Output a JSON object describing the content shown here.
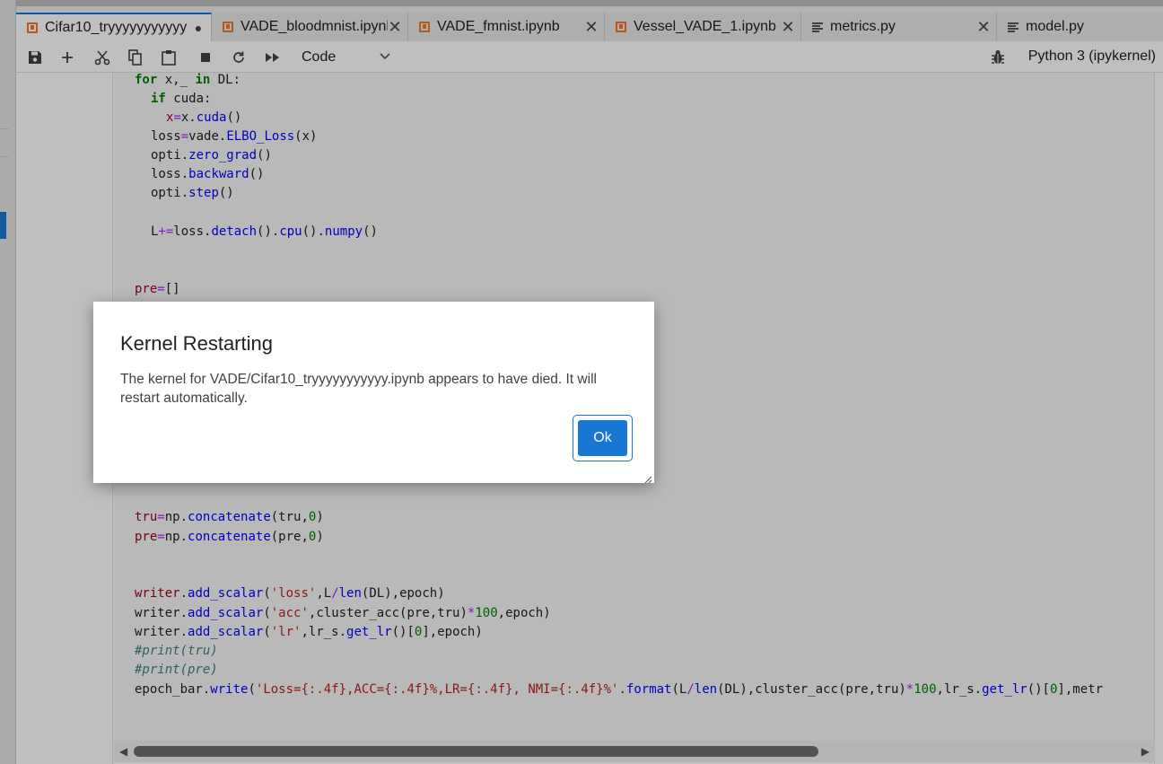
{
  "tabs": [
    {
      "label": "Cifar10_tryyyyyyyyyyy",
      "icon": "notebook-icon",
      "active": true,
      "modified": true
    },
    {
      "label": "VADE_bloodmnist.ipynb",
      "icon": "notebook-icon",
      "close": "✕"
    },
    {
      "label": "VADE_fmnist.ipynb",
      "icon": "notebook-icon",
      "close": "✕"
    },
    {
      "label": "Vessel_VADE_1.ipynb",
      "icon": "notebook-icon",
      "close": "✕"
    },
    {
      "label": "metrics.py",
      "icon": "text-file-icon",
      "close": "✕"
    },
    {
      "label": "model.py",
      "icon": "text-file-icon"
    }
  ],
  "toolbar": {
    "cell_type": "Code",
    "kernel_name": "Python 3 (ipykernel)",
    "icons": [
      "save-icon",
      "add-icon",
      "cut-icon",
      "copy-icon",
      "paste-icon",
      "stop-icon",
      "restart-icon",
      "run-all-icon",
      "bug-icon"
    ]
  },
  "code_lines": [
    "for x,_ in DL:",
    "if cuda:",
    "x=x.cuda()",
    "loss=vade.ELBO_Loss(x)",
    "opti.zero_grad()",
    "loss.backward()",
    "opti.step()",
    "L+=loss.detach().cpu().numpy()",
    "pre=[]",
    "tru=np.concatenate(tru,0)",
    "pre=np.concatenate(pre,0)",
    "writer.add_scalar('loss',L/len(DL),epoch)",
    "writer.add_scalar('acc',cluster_acc(pre,tru)*100,epoch)",
    "writer.add_scalar('lr',lr_s.get_lr()[0],epoch)",
    "#print(tru)",
    "#print(pre)",
    "epoch_bar.write('Loss={:.4f},ACC={:.4f}%,LR={:.4f}, NMI={:.4f}%'.format(L/len(DL),cluster_acc(pre,tru)*100,lr_s.get_lr()[0],metr"
  ],
  "dialog": {
    "title": "Kernel Restarting",
    "message": "The kernel for VADE/Cifar10_tryyyyyyyyyyy.ipynb appears to have died. It will restart automatically.",
    "ok_label": "Ok"
  },
  "colors": {
    "accent": "#1976d2",
    "notebook_icon": "#f37726",
    "overlay": "rgba(0,0,0,0.25)"
  }
}
